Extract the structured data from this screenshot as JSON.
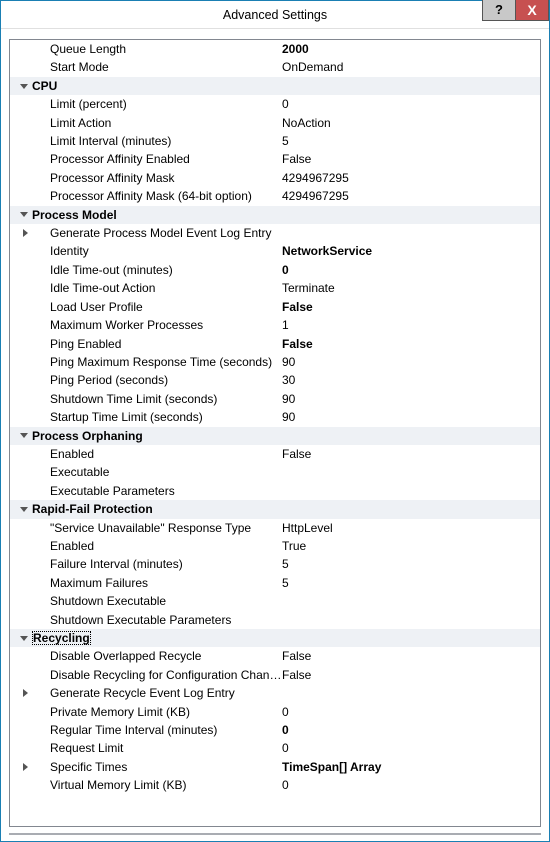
{
  "window": {
    "title": "Advanced Settings",
    "help": "?",
    "close": "X"
  },
  "rows": [
    {
      "type": "item",
      "label": "Queue Length",
      "value": "2000",
      "bold": true
    },
    {
      "type": "item",
      "label": "Start Mode",
      "value": "OnDemand"
    },
    {
      "type": "cat",
      "label": "CPU"
    },
    {
      "type": "item",
      "label": "Limit (percent)",
      "value": "0"
    },
    {
      "type": "item",
      "label": "Limit Action",
      "value": "NoAction"
    },
    {
      "type": "item",
      "label": "Limit Interval (minutes)",
      "value": "5"
    },
    {
      "type": "item",
      "label": "Processor Affinity Enabled",
      "value": "False"
    },
    {
      "type": "item",
      "label": "Processor Affinity Mask",
      "value": "4294967295"
    },
    {
      "type": "item",
      "label": "Processor Affinity Mask (64-bit option)",
      "value": "4294967295"
    },
    {
      "type": "cat",
      "label": "Process Model"
    },
    {
      "type": "sub",
      "label": "Generate Process Model Event Log Entry",
      "value": ""
    },
    {
      "type": "item",
      "label": "Identity",
      "value": "NetworkService",
      "bold": true
    },
    {
      "type": "item",
      "label": "Idle Time-out (minutes)",
      "value": "0",
      "bold": true
    },
    {
      "type": "item",
      "label": "Idle Time-out Action",
      "value": "Terminate"
    },
    {
      "type": "item",
      "label": "Load User Profile",
      "value": "False",
      "bold": true
    },
    {
      "type": "item",
      "label": "Maximum Worker Processes",
      "value": "1"
    },
    {
      "type": "item",
      "label": "Ping Enabled",
      "value": "False",
      "bold": true
    },
    {
      "type": "item",
      "label": "Ping Maximum Response Time (seconds)",
      "value": "90"
    },
    {
      "type": "item",
      "label": "Ping Period (seconds)",
      "value": "30"
    },
    {
      "type": "item",
      "label": "Shutdown Time Limit (seconds)",
      "value": "90"
    },
    {
      "type": "item",
      "label": "Startup Time Limit (seconds)",
      "value": "90"
    },
    {
      "type": "cat",
      "label": "Process Orphaning"
    },
    {
      "type": "item",
      "label": "Enabled",
      "value": "False"
    },
    {
      "type": "item",
      "label": "Executable",
      "value": ""
    },
    {
      "type": "item",
      "label": "Executable Parameters",
      "value": ""
    },
    {
      "type": "cat",
      "label": "Rapid-Fail Protection"
    },
    {
      "type": "item",
      "label": "\"Service Unavailable\" Response Type",
      "value": "HttpLevel"
    },
    {
      "type": "item",
      "label": "Enabled",
      "value": "True"
    },
    {
      "type": "item",
      "label": "Failure Interval (minutes)",
      "value": "5"
    },
    {
      "type": "item",
      "label": "Maximum Failures",
      "value": "5"
    },
    {
      "type": "item",
      "label": "Shutdown Executable",
      "value": ""
    },
    {
      "type": "item",
      "label": "Shutdown Executable Parameters",
      "value": ""
    },
    {
      "type": "cat",
      "label": "Recycling",
      "selected": true
    },
    {
      "type": "item",
      "label": "Disable Overlapped Recycle",
      "value": "False"
    },
    {
      "type": "item",
      "label": "Disable Recycling for Configuration Changes",
      "value": "False"
    },
    {
      "type": "sub",
      "label": "Generate Recycle Event Log Entry",
      "value": ""
    },
    {
      "type": "item",
      "label": "Private Memory Limit (KB)",
      "value": "0"
    },
    {
      "type": "item",
      "label": "Regular Time Interval (minutes)",
      "value": "0",
      "bold": true
    },
    {
      "type": "item",
      "label": "Request Limit",
      "value": "0"
    },
    {
      "type": "sub",
      "label": "Specific Times",
      "value": "TimeSpan[] Array",
      "bold": true
    },
    {
      "type": "item",
      "label": "Virtual Memory Limit (KB)",
      "value": "0"
    }
  ]
}
